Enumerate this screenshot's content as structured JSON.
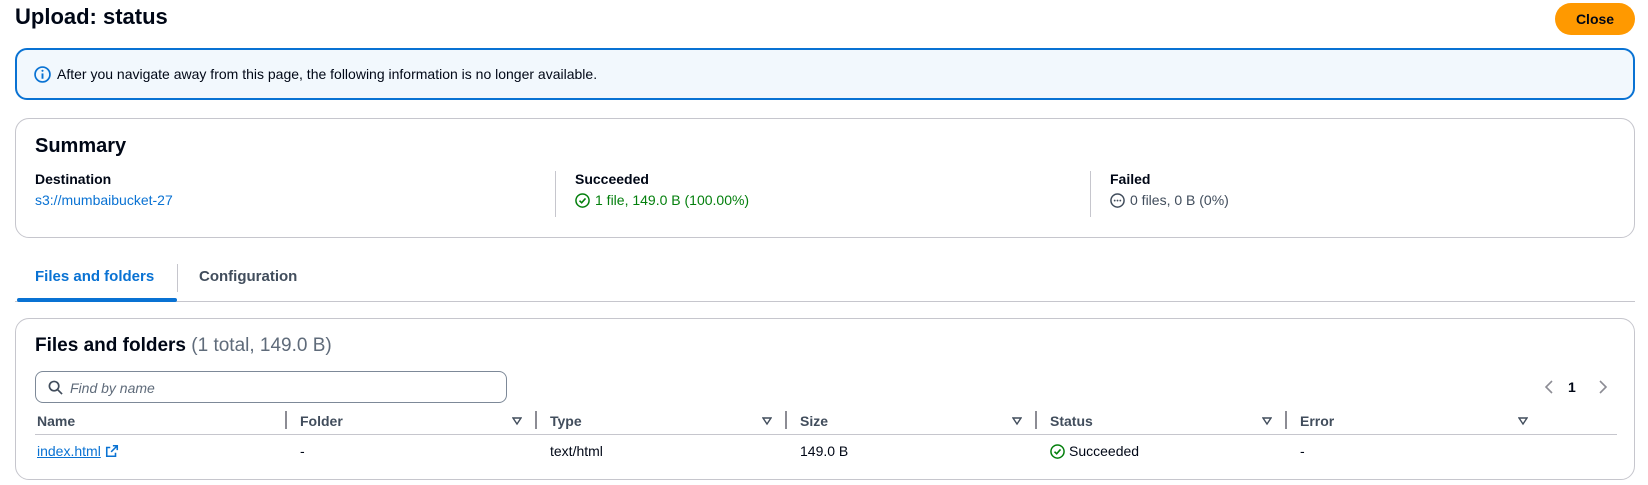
{
  "header": {
    "title": "Upload: status",
    "close_label": "Close"
  },
  "alert": {
    "icon": "info-icon",
    "text": "After you navigate away from this page, the following information is no longer available."
  },
  "summary": {
    "title": "Summary",
    "destination": {
      "label": "Destination",
      "value": "s3://mumbaibucket-27"
    },
    "succeeded": {
      "label": "Succeeded",
      "icon": "success-check-icon",
      "value": "1 file, 149.0 B (100.00%)"
    },
    "failed": {
      "label": "Failed",
      "icon": "pending-ellipsis-icon",
      "value": "0 files, 0 B (0%)"
    }
  },
  "tabs": [
    {
      "label": "Files and folders",
      "active": true
    },
    {
      "label": "Configuration",
      "active": false
    }
  ],
  "files": {
    "title": "Files and folders",
    "count": "(1 total, 149.0 B)",
    "search_placeholder": "Find by name",
    "page": "1",
    "columns": [
      "Name",
      "Folder",
      "Type",
      "Size",
      "Status",
      "Error"
    ],
    "rows": [
      {
        "name": "index.html",
        "folder": "-",
        "type": "text/html",
        "size": "149.0 B",
        "status": "Succeeded",
        "error": "-"
      }
    ]
  },
  "colors": {
    "accent": "#0972d3",
    "primary_button": "#ff9900",
    "success": "#037f0c",
    "border": "#c6c6cd"
  }
}
